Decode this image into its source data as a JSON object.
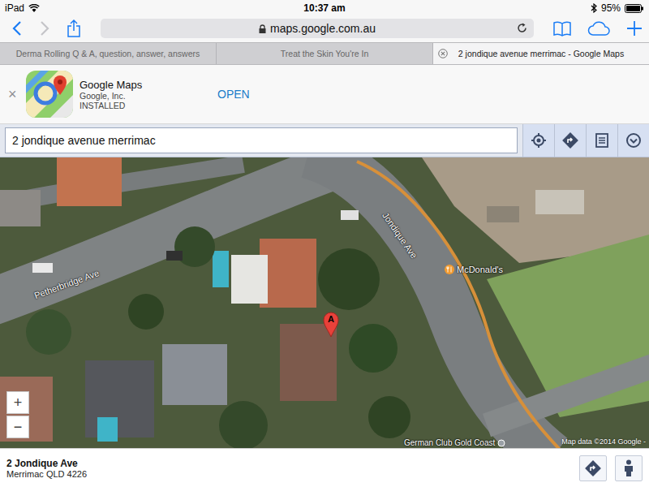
{
  "status_bar": {
    "device": "iPad",
    "time": "10:37 am",
    "battery": "95%"
  },
  "toolbar": {
    "url": "maps.google.com.au"
  },
  "tabs": [
    {
      "label": "Derma Rolling Q & A, question, answer, answers",
      "selected": false
    },
    {
      "label": "Treat the Skin You're In",
      "selected": false
    },
    {
      "label": "2 jondique avenue merrimac - Google Maps",
      "selected": true
    }
  ],
  "app_banner": {
    "close": "×",
    "name": "Google Maps",
    "publisher": "Google, Inc.",
    "status": "INSTALLED",
    "action": "OPEN"
  },
  "search": {
    "value": "2 jondique avenue merrimac"
  },
  "map": {
    "labels": [
      {
        "text": "Petherbridge Ave",
        "kind": "street"
      },
      {
        "text": "Jondique Ave",
        "kind": "street"
      },
      {
        "text": "McDonald's",
        "kind": "poi"
      },
      {
        "text": "German Club Gold Coast",
        "kind": "poi"
      }
    ],
    "pin": "A",
    "zoom": [
      "+",
      "−"
    ],
    "attribution": "Map data ©2014 Google -"
  },
  "place": {
    "title": "2 Jondique Ave",
    "address": "Merrimac QLD 4226"
  }
}
